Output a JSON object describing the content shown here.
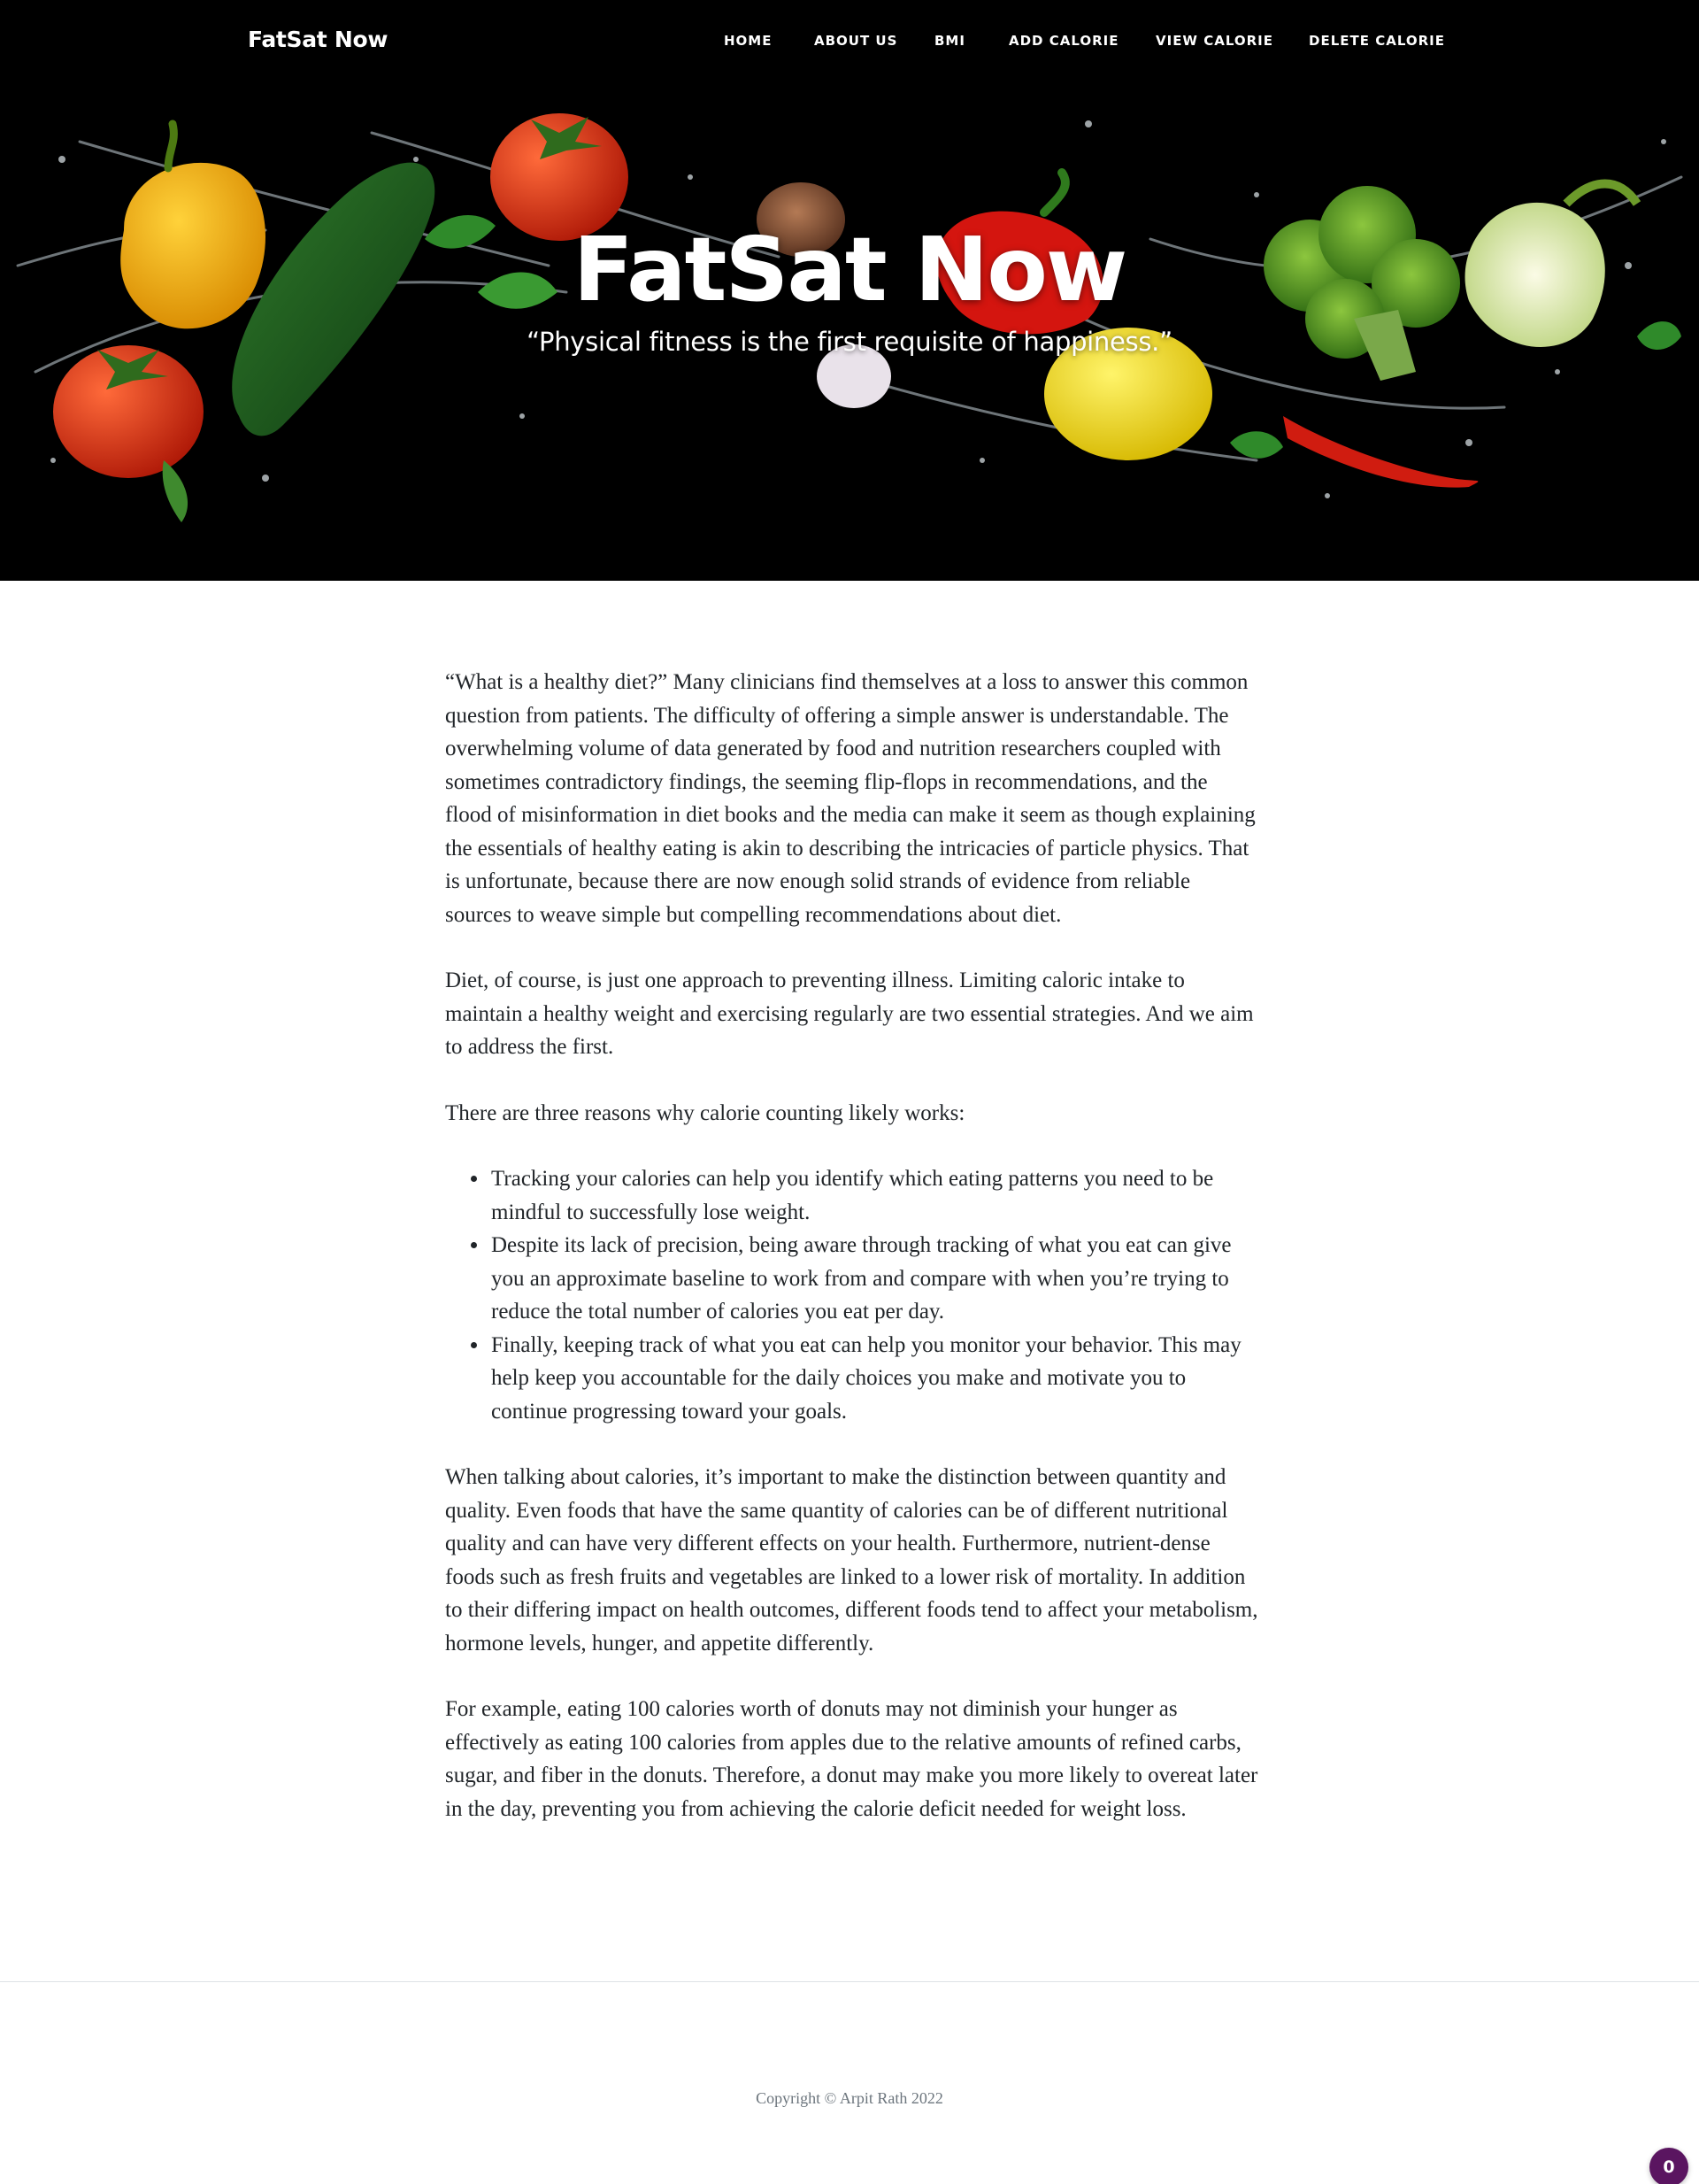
{
  "navbar": {
    "brand": "FatSat Now",
    "links": [
      "HOME",
      "ABOUT US",
      "BMI",
      "ADD CALORIE",
      "VIEW CALORIE",
      "DELETE CALORIE"
    ]
  },
  "hero": {
    "title": "FatSat Now",
    "subheading": "“Physical fitness is the first requisite of happiness.”"
  },
  "article": {
    "paragraphs": [
      "“What is a healthy diet?” Many clinicians find themselves at a loss to answer this common question from patients. The difficulty of offering a simple answer is understandable. The overwhelming volume of data generated by food and nutrition researchers coupled with sometimes contradictory findings, the seeming flip-flops in recommendations, and the flood of misinformation in diet books and the media can make it seem as though explaining the essentials of healthy eating is akin to describing the intricacies of particle physics. That is unfortunate, because there are now enough solid strands of evidence from reliable sources to weave simple but compelling recommendations about diet.",
      "Diet, of course, is just one approach to preventing illness. Limiting caloric intake to maintain a healthy weight and exercising regularly are two essential strategies. And we aim to address the first.",
      "There are three reasons why calorie counting likely works:",
      "When talking about calories, it’s important to make the distinction between quantity and quality. Even foods that have the same quantity of calories can be of different nutritional quality and can have very different effects on your health. Furthermore, nutrient-dense foods such as fresh fruits and vegetables are linked to a lower risk of mortality. In addition to their differing impact on health outcomes, different foods tend to affect your metabolism, hormone levels, hunger, and appetite differently.",
      "For example, eating 100 calories worth of donuts may not diminish your hunger as effectively as eating 100 calories from apples due to the relative amounts of refined carbs, sugar, and fiber in the donuts. Therefore, a donut may make you more likely to overeat later in the day, preventing you from achieving the calorie deficit needed for weight loss."
    ],
    "reasons": [
      "Tracking your calories can help you identify which eating patterns you need to be mindful to successfully lose weight.",
      "Despite its lack of precision, being aware through tracking of what you eat can give you an approximate baseline to work from and compare with when you’re trying to reduce the total number of calories you eat per day.",
      "Finally, keeping track of what you eat can help you monitor your behavior. This may help keep you accountable for the daily choices you make and motivate you to continue progressing toward your goals."
    ]
  },
  "footer": {
    "copyright": "Copyright © Arpit Rath 2022"
  },
  "badge": {
    "count": "0",
    "color": "#5a1560"
  }
}
